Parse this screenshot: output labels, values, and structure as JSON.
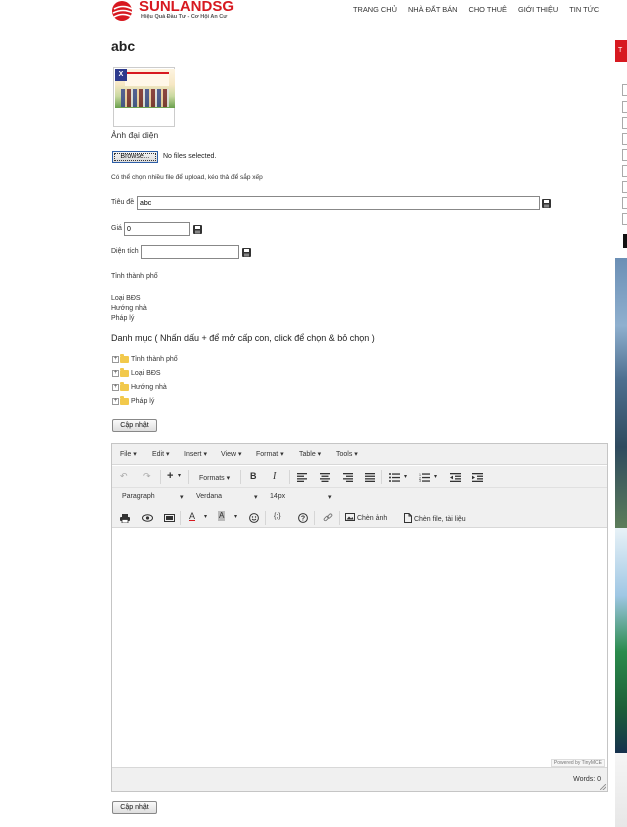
{
  "header": {
    "logo_main": "SUNLAND",
    "logo_suffix": "SG",
    "logo_tagline": "Hiệu Quả Đầu Tư - Cơ Hội An Cư",
    "nav": [
      "TRANG CHỦ",
      "NHÀ ĐẤT BÁN",
      "CHO THUÊ",
      "GIỚI THIỆU",
      "TIN TỨC"
    ]
  },
  "page": {
    "title": "abc"
  },
  "upload": {
    "delete_label": "X",
    "avatar_label": "Ảnh đại diện",
    "browse_label": "Browse...",
    "no_file_text": "No files selected.",
    "hint": "Có thể chọn nhiều file để upload, kéo thả để sắp xếp"
  },
  "form": {
    "title_label": "Tiêu đề",
    "title_value": "abc",
    "price_label": "Giá",
    "price_value": "0",
    "area_label": "Diện tích",
    "area_value": "",
    "province_label": "Tỉnh thành phố",
    "type_label": "Loại BĐS",
    "direction_label": "Hướng nhà",
    "legal_label": "Pháp lý",
    "category_heading": "Danh mục ( Nhấn dấu + để mở cấp con, click để chọn & bỏ chọn )",
    "tree": [
      "Tỉnh thành phố",
      "Loại BĐS",
      "Hướng nhà",
      "Pháp lý"
    ],
    "update_label": "Cập nhật"
  },
  "editor": {
    "menus": [
      "File",
      "Edit",
      "Insert",
      "View",
      "Format",
      "Table",
      "Tools"
    ],
    "formats_label": "Formats",
    "block_select": "Paragraph",
    "font_select": "Verdana",
    "size_select": "14px",
    "insert_image_label": "Chèn ảnh",
    "insert_file_label": "Chèn file, tài liệu",
    "code_label": "{;}",
    "powered_by": "Powered by TinyMCE",
    "word_count": "Words: 0"
  },
  "sidebar": {
    "tab_letter": "T"
  },
  "colors": {
    "brand_red": "#d71920",
    "editor_bg": "#f0f0f0"
  }
}
